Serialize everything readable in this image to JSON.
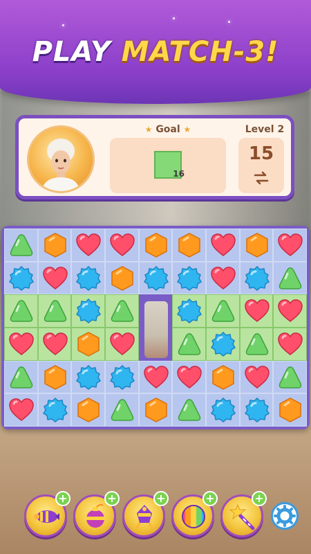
{
  "banner": {
    "title_part1": "PLAY ",
    "title_part2": "MATCH-3!"
  },
  "goal_panel": {
    "goal_label": "Goal",
    "goal_count": "16",
    "level_label": "Level 2",
    "moves": "15",
    "icons": [
      "star-icon",
      "green-tile-icon",
      "swap-icon"
    ]
  },
  "board": {
    "rows": [
      [
        "triangle",
        "hexagon",
        "heart",
        "heart",
        "hexagon",
        "hexagon",
        "heart",
        "hexagon",
        "heart"
      ],
      [
        "star",
        "heart",
        "star",
        "hexagon",
        "star",
        "star",
        "heart",
        "star",
        "triangle"
      ],
      [
        "triangle",
        "triangle",
        "star",
        "triangle",
        "none",
        "star",
        "triangle",
        "heart",
        "heart"
      ],
      [
        "heart",
        "heart",
        "hexagon",
        "heart",
        "none",
        "triangle",
        "star",
        "triangle",
        "heart"
      ],
      [
        "triangle",
        "hexagon",
        "star",
        "star",
        "heart",
        "heart",
        "hexagon",
        "heart",
        "triangle"
      ],
      [
        "heart",
        "star",
        "hexagon",
        "triangle",
        "hexagon",
        "triangle",
        "star",
        "star",
        "hexagon"
      ]
    ],
    "green_cells_rows": [
      2,
      3
    ],
    "colors": {
      "triangle": "#6fd36a",
      "hexagon": "#ff9a1f",
      "heart": "#ff4f6a",
      "star": "#2fb5f0"
    }
  },
  "boosters": {
    "items": [
      "rocket-booster-icon",
      "bomb-booster-icon",
      "lamp-booster-icon",
      "rainbow-ball-booster-icon",
      "magic-wand-booster-icon"
    ],
    "plus_label": "+"
  },
  "settings": {
    "icon": "gear-icon"
  },
  "colors": {
    "banner": "#8a3fc9",
    "panel_border": "#7c4fc1",
    "title_white": "#ffffff",
    "title_yellow": "#ffd84a"
  }
}
